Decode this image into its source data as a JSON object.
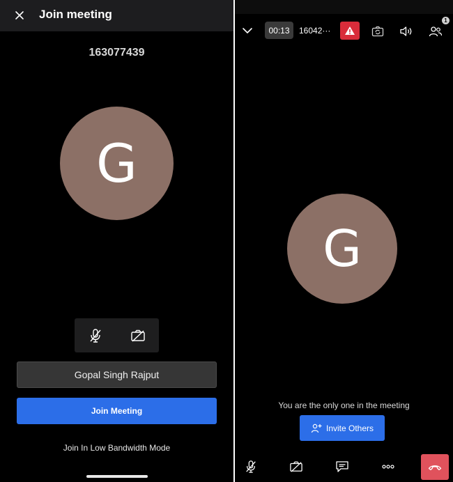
{
  "join_screen": {
    "title": "Join meeting",
    "meeting_id": "163077439",
    "avatar_initial": "G",
    "icons": {
      "close": "close-icon",
      "mic": "mic-off-icon",
      "camera": "camera-off-icon"
    },
    "name_value": "Gopal Singh Rajput",
    "join_button_label": "Join Meeting",
    "low_bandwidth_label": "Join In Low Bandwidth Mode"
  },
  "meeting_screen": {
    "timer": "00:13",
    "meeting_number": "16042···",
    "participants_count": "1",
    "icons": {
      "collapse": "chevron-down-icon",
      "alert": "warning-icon",
      "switch_camera": "switch-camera-icon",
      "speaker": "speaker-icon",
      "participants": "participants-icon",
      "mic": "mic-off-icon",
      "camera": "camera-off-icon",
      "chat": "chat-icon",
      "more": "more-icon",
      "end_call": "end-call-icon",
      "invite": "add-person-icon"
    },
    "avatar_initial": "G",
    "status_text": "You are the only one in the meeting",
    "invite_button_label": "Invite Others"
  },
  "colors": {
    "background": "#000000",
    "header": "#1d1d1f",
    "accent_blue": "#2c6ee8",
    "avatar": "#8c7066",
    "alert_red": "#d92c3a",
    "end_call_red": "#e0525c"
  }
}
